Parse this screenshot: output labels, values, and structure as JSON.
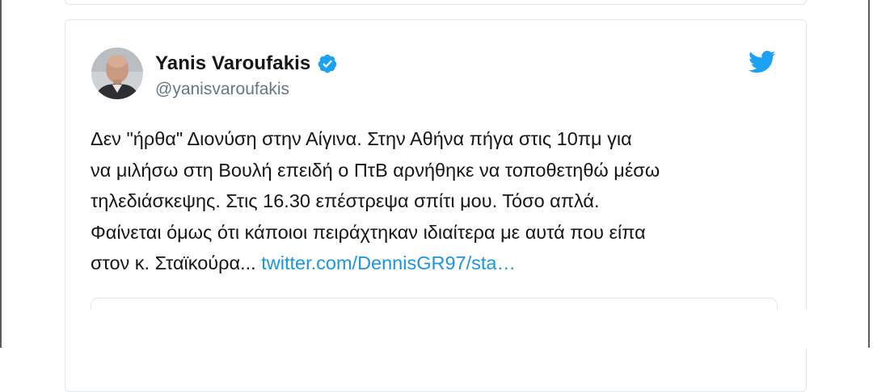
{
  "tweet": {
    "author_name": "Yanis Varoufakis",
    "handle": "@yanisvaroufakis",
    "text_lines": [
      "Δεν \"ήρθα\" Διονύση στην Αίγινα.  Στην Αθήνα πήγα στις 10πμ για",
      "να μιλήσω στη Βουλή επειδή ο ΠτΒ αρνήθηκε να τοποθετηθώ μέσω",
      "τηλεδιάσκεψης. Στις 16.30 επέστρεψα σπίτι μου. Τόσο απλά.",
      "Φαίνεται όμως ότι κάποιοι πειράχτηκαν ιδιαίτερα με αυτά που είπα",
      "στον κ. Σταϊκούρα... "
    ],
    "link_text": "twitter.com/DennisGR97/sta…",
    "verified_icon": "verified-badge-icon",
    "brand_icon": "twitter-bird-icon",
    "colors": {
      "text": "#14171a",
      "handle": "#657786",
      "link": "#1b95e0",
      "brand": "#1da1f2",
      "border": "#e1e8ed"
    }
  }
}
